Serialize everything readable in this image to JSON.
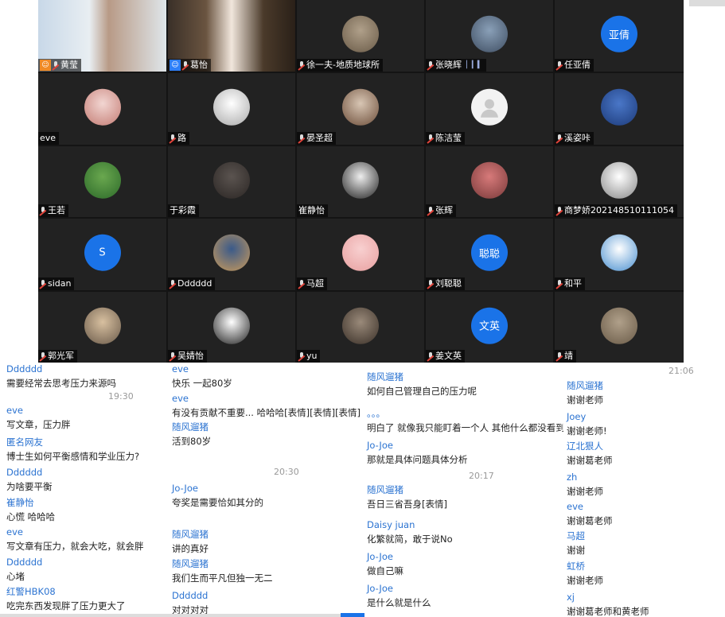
{
  "participants": [
    {
      "name": "黄莹",
      "badge": "host",
      "avatar": "camera"
    },
    {
      "name": "葛怡",
      "badge": "cohost",
      "avatar": "camera"
    },
    {
      "name": "徐一夫-地质地球所",
      "avatar": "photo"
    },
    {
      "name": "张晓辉",
      "avatar": "photo",
      "signal": true
    },
    {
      "name": "任亚倩",
      "avatar": "initials",
      "initials": "亚倩"
    },
    {
      "name": "eve",
      "avatar": "photo",
      "muted": false
    },
    {
      "name": "路",
      "avatar": "photo"
    },
    {
      "name": "晏圣超",
      "avatar": "photo"
    },
    {
      "name": "陈洁莹",
      "avatar": "default"
    },
    {
      "name": "溪姿咔",
      "avatar": "photo"
    },
    {
      "name": "王若",
      "avatar": "photo"
    },
    {
      "name": "于彩霞",
      "avatar": "photo",
      "muted": false
    },
    {
      "name": "崔静怡",
      "avatar": "photo",
      "muted": false
    },
    {
      "name": "张辉",
      "avatar": "photo"
    },
    {
      "name": "商梦娇202148510111054",
      "avatar": "photo"
    },
    {
      "name": "sidan",
      "avatar": "initials",
      "initials": "S"
    },
    {
      "name": "Dddddd",
      "avatar": "photo"
    },
    {
      "name": "马超",
      "avatar": "photo"
    },
    {
      "name": "刘聪聪",
      "avatar": "initials",
      "initials": "聪聪"
    },
    {
      "name": "和平",
      "avatar": "photo"
    },
    {
      "name": "郭光军",
      "avatar": "photo"
    },
    {
      "name": "吴婧怡",
      "avatar": "photo"
    },
    {
      "name": "yu",
      "avatar": "photo"
    },
    {
      "name": "姜文英",
      "avatar": "initials",
      "initials": "文英"
    },
    {
      "name": "靖",
      "avatar": "photo"
    }
  ],
  "chat": {
    "col1": {
      "messages": [
        {
          "sender": "Dddddd",
          "text": "需要经常去思考压力来源吗"
        },
        {
          "sender": "eve",
          "text": "写文章，压力胖"
        },
        {
          "sender": "匿名网友",
          "text": "博士生如何平衡感情和学业压力?"
        },
        {
          "sender": "Dddddd",
          "text": "为啥要平衡"
        },
        {
          "sender": "崔静怡",
          "text": "心慌 哈哈哈"
        },
        {
          "sender": "eve",
          "text": "写文章有压力，就会大吃，就会胖"
        },
        {
          "sender": "Dddddd",
          "text": "心堵"
        },
        {
          "sender": "红警HBK08",
          "text": "吃完东西发现胖了压力更大了"
        }
      ],
      "timestamp": "19:30"
    },
    "col2": {
      "messages": [
        {
          "sender": "eve",
          "text": "快乐 一起80岁"
        },
        {
          "sender": "eve",
          "text": "有没有贡献不重要... 哈哈哈[表情][表情][表情]"
        },
        {
          "sender": "随风遛猪",
          "text": "活到80岁"
        },
        {
          "sender": "Jo-Joe",
          "text": "夸奖是需要恰如其分的"
        },
        {
          "sender": "随风遛猪",
          "text": "讲的真好"
        },
        {
          "sender": "随风遛猪",
          "text": "我们生而平凡但独一无二"
        },
        {
          "sender": "Dddddd",
          "text": "对对对对"
        }
      ],
      "timestamp": "20:30"
    },
    "col3": {
      "messages": [
        {
          "sender": "随风遛猪",
          "text": "如何自己管理自己的压力呢"
        },
        {
          "sender": "。。。",
          "text": "明白了 就像我只能盯着一个人 其他什么都没看到"
        },
        {
          "sender": "Jo-Joe",
          "text": "那就是具体问题具体分析"
        },
        {
          "sender": "随风遛猪",
          "text": "吾日三省吾身[表情]"
        },
        {
          "sender": "Daisy juan",
          "text": "化繁就简，敢于说No"
        },
        {
          "sender": "Jo-Joe",
          "text": "做自己嘛"
        },
        {
          "sender": "Jo-Joe",
          "text": "是什么就是什么"
        }
      ],
      "timestamp": "20:17"
    },
    "col4": {
      "messages": [
        {
          "sender": "随风遛猪",
          "text": "谢谢老师"
        },
        {
          "sender": "Joey",
          "text": "谢谢老师!"
        },
        {
          "sender": "辽北狠人",
          "text": "谢谢葛老师"
        },
        {
          "sender": "zh",
          "text": "谢谢老师"
        },
        {
          "sender": "eve",
          "text": "谢谢葛老师"
        },
        {
          "sender": "马超",
          "text": "谢谢"
        },
        {
          "sender": "虹桥",
          "text": "谢谢老师"
        },
        {
          "sender": "xj",
          "text": "谢谢葛老师和黄老师"
        }
      ],
      "timestamp": "21:06"
    }
  }
}
